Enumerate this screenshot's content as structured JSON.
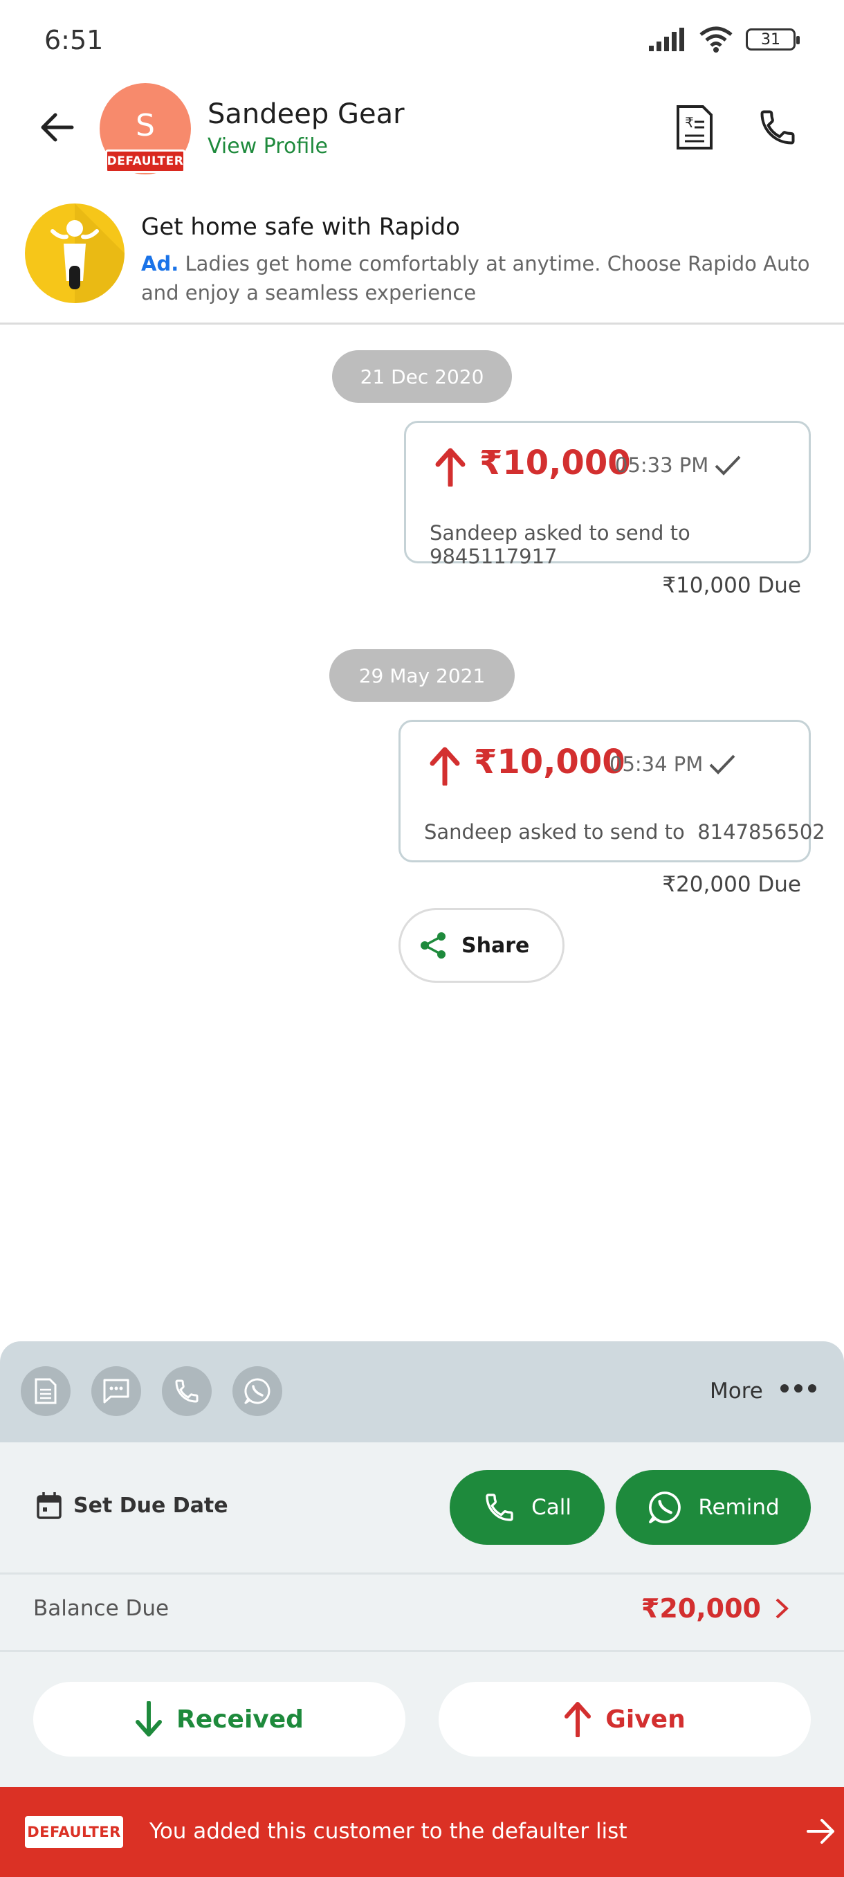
{
  "status_bar": {
    "time": "6:51",
    "battery": "31"
  },
  "header": {
    "avatar_initial": "S",
    "defaulter_tag": "DEFAULTER",
    "name": "Sandeep Gear",
    "view_profile": "View Profile",
    "icons": [
      "back-arrow-icon",
      "bill-document-icon",
      "phone-icon"
    ]
  },
  "ad": {
    "title": "Get home safe with Rapido",
    "label": "Ad.",
    "description": "Ladies get home comfortably at anytime. Choose Rapido Auto and enjoy a seamless experience"
  },
  "transactions": [
    {
      "date": "21 Dec 2020",
      "amount": "₹10,000",
      "time": "05:33 PM",
      "note": "Sandeep asked to send to 9845117917",
      "due": "₹10,000 Due"
    },
    {
      "date": "29 May 2021",
      "amount": "₹10,000",
      "time": "05:34 PM",
      "note": "Sandeep asked to send to  8147856502",
      "due": "₹20,000 Due"
    }
  ],
  "share_label": "Share",
  "quick_bar": {
    "more_label": "More",
    "icons": [
      "document-icon",
      "message-icon",
      "phone-icon",
      "whatsapp-icon"
    ]
  },
  "actions": {
    "set_due_date": "Set Due Date",
    "call": "Call",
    "remind": "Remind"
  },
  "balance": {
    "label": "Balance Due",
    "value": "₹20,000"
  },
  "buttons": {
    "received": "Received",
    "given": "Given"
  },
  "defaulter_bar": {
    "badge": "DEFAULTER",
    "text": "You added this customer to the defaulter list"
  },
  "colors": {
    "green": "#1e8a3c",
    "red": "#d32f2f",
    "defaulter_red": "#db3125",
    "avatar": "#f78a6c"
  }
}
